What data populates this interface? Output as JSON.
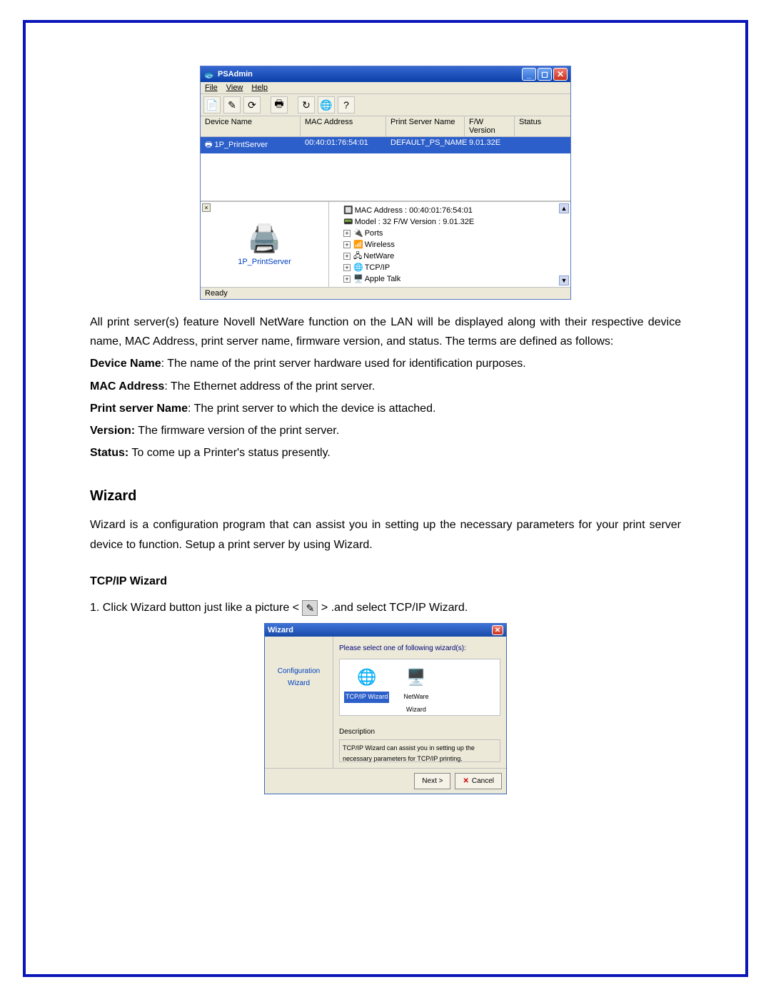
{
  "psadmin": {
    "title": "PSAdmin",
    "menu": {
      "file": "File",
      "view": "View",
      "help": "Help"
    },
    "list": {
      "headers": {
        "device_name": "Device Name",
        "mac_address": "MAC Address",
        "print_server_name": "Print Server Name",
        "fw_version": "F/W Version",
        "status": "Status"
      },
      "row": {
        "device_name": "1P_PrintServer",
        "mac_address": "00:40:01:76:54:01",
        "print_server_name": "DEFAULT_PS_NAME",
        "fw_version": "9.01.32E",
        "status": ""
      }
    },
    "leftpane": {
      "label": "1P_PrintServer"
    },
    "tree": {
      "mac": "MAC Address : 00:40:01:76:54:01",
      "model": "Model : 32  F/W Version : 9.01.32E",
      "ports": "Ports",
      "wireless": "Wireless",
      "netware": "NetWare",
      "tcpip": "TCP/IP",
      "appletalk": "Apple Talk"
    },
    "statusbar": "Ready"
  },
  "doc": {
    "intro": "All print server(s) feature Novell NetWare function on the LAN will be displayed along with their respective device name, MAC Address, print server name, firmware version, and status. The terms are defined as follows:",
    "defs": {
      "device_name_l": "Device Name",
      "device_name_t": ": The name of the print server hardware used for identification purposes.",
      "mac_l": "MAC Address",
      "mac_t": ": The Ethernet address of the print server.",
      "psn_l": "Print server Name",
      "psn_t": ": The print server to which the device is attached.",
      "ver_l": "Version:",
      "ver_t": " The firmware version of the print server.",
      "stat_l": "Status:",
      "stat_t": " To come up a Printer's status presently."
    },
    "wizard_h": "Wizard",
    "wizard_p": "Wizard is a configuration program that can assist you in setting up the necessary parameters for your print server device to function. Setup a print server by using Wizard.",
    "tcpip_h": "TCP/IP Wizard",
    "tcpip_step_a": "1. Click Wizard button just like a picture  <",
    "tcpip_step_b": "> .and select TCP/IP Wizard."
  },
  "wizard": {
    "title": "Wizard",
    "left_l1": "Configuration",
    "left_l2": "Wizard",
    "instr": "Please select one of following wizard(s):",
    "icons": {
      "tcpip": "TCP/IP Wizard",
      "netware_l1": "NetWare",
      "netware_l2": "Wizard"
    },
    "desc_hdr": "Description",
    "desc_txt": "TCP/IP Wizard can assist you in setting up the necessary parameters for TCP/IP printing.",
    "btn_next": "Next  >",
    "btn_cancel": "Cancel"
  }
}
